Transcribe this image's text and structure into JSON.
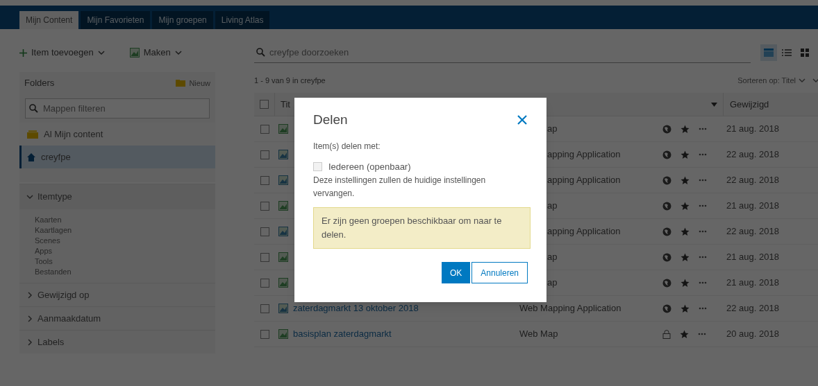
{
  "tabs": [
    {
      "label": "Mijn Content",
      "selected": true
    },
    {
      "label": "Mijn Favorieten",
      "selected": false
    },
    {
      "label": "Mijn groepen",
      "selected": false
    },
    {
      "label": "Living Atlas",
      "selected": false
    }
  ],
  "toolbar": {
    "add": "Item toevoegen",
    "create": "Maken"
  },
  "folders": {
    "title": "Folders",
    "new": "Nieuw",
    "filter_placeholder": "Mappen filteren",
    "items": [
      {
        "label": "Al Mijn content",
        "kind": "all",
        "selected": false
      },
      {
        "label": "creyfpe",
        "kind": "home",
        "selected": true
      }
    ]
  },
  "filters": [
    {
      "label": "Itemtype",
      "expanded": true,
      "options": [
        "Kaarten",
        "Kaartlagen",
        "Scenes",
        "Apps",
        "Tools",
        "Bestanden"
      ]
    },
    {
      "label": "Gewijzigd op",
      "expanded": false
    },
    {
      "label": "Aanmaakdatum",
      "expanded": false
    },
    {
      "label": "Labels",
      "expanded": false
    }
  ],
  "search": {
    "placeholder": "creyfpe doorzoeken"
  },
  "views": [
    {
      "kind": "table",
      "selected": true
    },
    {
      "kind": "list",
      "selected": false
    },
    {
      "kind": "grid",
      "selected": false
    }
  ],
  "count": "1 - 9 van 9 in creyfpe",
  "sort": "Sorteren op: Titel",
  "table": {
    "columns": [
      "Tit",
      "Gewijzigd"
    ],
    "all_checked": false,
    "rows": [
      {
        "checked": false,
        "kind": "map",
        "type": "ap",
        "public": true,
        "date": "21 aug. 2018"
      },
      {
        "checked": false,
        "kind": "app",
        "type": "apping Application",
        "public": true,
        "date": "22 aug. 2018"
      },
      {
        "checked": false,
        "kind": "app",
        "type": "apping Application",
        "public": true,
        "date": "22 aug. 2018"
      },
      {
        "checked": false,
        "kind": "map",
        "type": "ap",
        "public": true,
        "date": "21 aug. 2018"
      },
      {
        "checked": false,
        "kind": "app",
        "type": "apping Application",
        "public": true,
        "date": "22 aug. 2018"
      },
      {
        "checked": false,
        "kind": "map",
        "type": "ap",
        "public": true,
        "date": "21 aug. 2018"
      },
      {
        "checked": false,
        "kind": "map",
        "type": "ap",
        "public": true,
        "date": "21 aug. 2018"
      },
      {
        "checked": false,
        "kind": "app",
        "title": "zaterdagmarkt 13 oktober 2018",
        "type": "Web Mapping Application",
        "public": true,
        "date": "22 aug. 2018"
      },
      {
        "checked": false,
        "kind": "map",
        "title": "basisplan zaterdagmarkt",
        "type": "Web Map",
        "public": false,
        "date": "20 aug. 2018"
      }
    ]
  },
  "dialog": {
    "title": "Delen",
    "prompt": "Item(s) delen met:",
    "option": {
      "label": "Iedereen (openbaar)",
      "checked": false
    },
    "note": "Deze instellingen zullen de huidige instellingen vervangen.",
    "alert": "Er zijn geen groepen beschikbaar om naar te delen.",
    "ok": "OK",
    "cancel": "Annuleren"
  }
}
